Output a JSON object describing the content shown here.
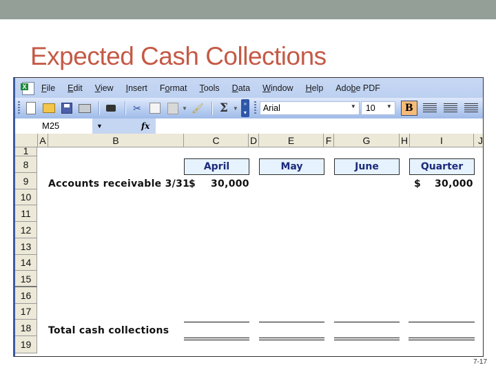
{
  "slide": {
    "title": "Expected Cash Collections",
    "page_number": "7-17",
    "accent_color": "#c45a46",
    "topbar_color": "#939f97"
  },
  "menubar": {
    "items": [
      {
        "label": "File",
        "accel": "F"
      },
      {
        "label": "Edit",
        "accel": "E"
      },
      {
        "label": "View",
        "accel": "V"
      },
      {
        "label": "Insert",
        "accel": "I"
      },
      {
        "label": "Format",
        "accel": "o"
      },
      {
        "label": "Tools",
        "accel": "T"
      },
      {
        "label": "Data",
        "accel": "D"
      },
      {
        "label": "Window",
        "accel": "W"
      },
      {
        "label": "Help",
        "accel": "H"
      },
      {
        "label": "Adobe PDF",
        "accel": "b"
      }
    ]
  },
  "toolbar": {
    "icons": [
      "new-icon",
      "open-icon",
      "save-icon",
      "print-icon",
      "camera-icon",
      "cut-icon",
      "copy-icon",
      "paste-icon",
      "format-painter-icon",
      "autosum-icon"
    ],
    "sum_glyph": "Σ",
    "font_name": "Arial",
    "font_size": "10",
    "bold_label": "B"
  },
  "formula_bar": {
    "name_box": "M25",
    "fx_label": "fx",
    "formula": ""
  },
  "sheet": {
    "columns": [
      "A",
      "B",
      "C",
      "D",
      "E",
      "F",
      "G",
      "H",
      "I",
      "J"
    ],
    "rows": [
      "1",
      "8",
      "9",
      "10",
      "11",
      "12",
      "13",
      "14",
      "15",
      "16",
      "17",
      "18",
      "19"
    ],
    "headers": {
      "april": "April",
      "may": "May",
      "june": "June",
      "quarter": "Quarter"
    },
    "ar_label": "Accounts receivable 3/31",
    "ar_april_currency": "$",
    "ar_april_value": "30,000",
    "ar_quarter_currency": "$",
    "ar_quarter_value": "30,000",
    "total_label": "Total cash collections"
  }
}
